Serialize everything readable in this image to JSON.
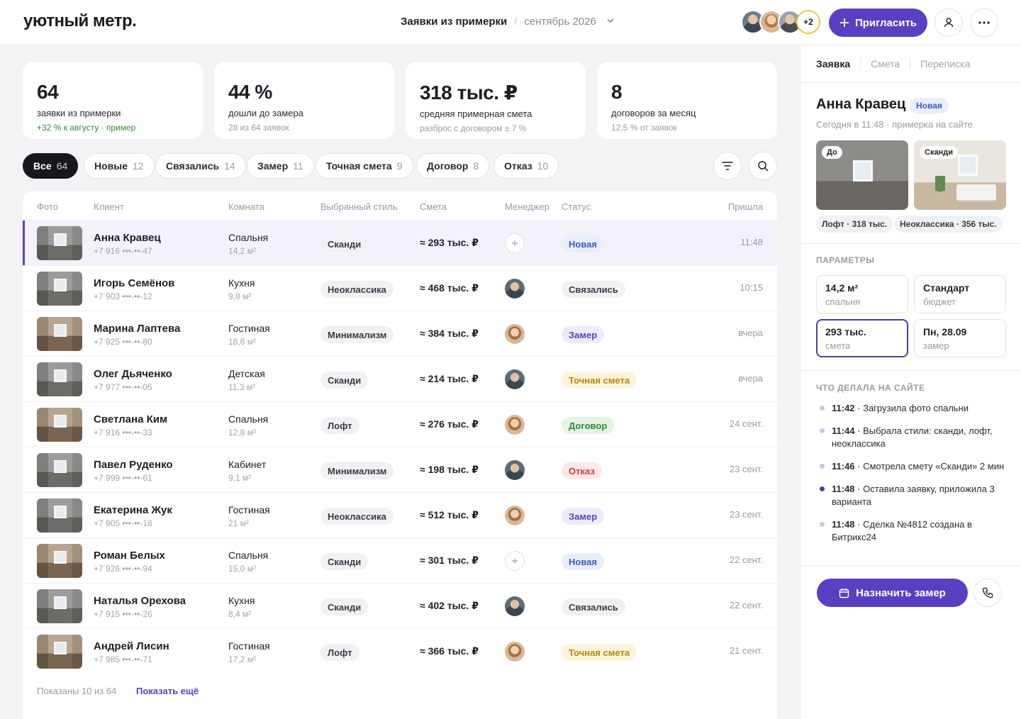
{
  "header": {
    "logo": "уютный метр.",
    "breadcrumb_current": "Заявки из примерки",
    "breadcrumb_sep": "/",
    "period": "сентябрь 2026",
    "avatars_more": "+2",
    "invite_label": "Пригласить"
  },
  "kpis": [
    {
      "value": "64",
      "label": "заявки из примерки",
      "sub": "+32 % к августу · пример"
    },
    {
      "value": "44 %",
      "label": "дошли до замера",
      "sub": "28 из 64 заявок"
    },
    {
      "value": "318 тыс. ₽",
      "label": "средняя примерная смета",
      "sub": "разброс с договором ± 7 %"
    },
    {
      "value": "8",
      "label": "договоров за месяц",
      "sub": "12,5 % от заявок"
    }
  ],
  "filters": [
    {
      "label": "Все",
      "count": "64"
    },
    {
      "label": "Новые",
      "count": "12"
    },
    {
      "label": "Связались",
      "count": "14"
    },
    {
      "label": "Замер",
      "count": "11"
    },
    {
      "label": "Точная смета",
      "count": "9"
    },
    {
      "label": "Договор",
      "count": "8"
    },
    {
      "label": "Отказ",
      "count": "10"
    }
  ],
  "table": {
    "columns": [
      "Фото",
      "Клиент",
      "Комната",
      "Выбранный стиль",
      "Смета",
      "Менеджер",
      "Статус",
      "Пришла"
    ],
    "rows": [
      {
        "name": "Анна Кравец",
        "phone": "+7 916 •••-••-47",
        "room": "Спальня",
        "area": "14,2 м²",
        "style": "Сканди",
        "estimate": "≈ 293 тыс. ₽",
        "status": "Новая",
        "came": "11:48"
      },
      {
        "name": "Игорь Семёнов",
        "phone": "+7 903 •••-••-12",
        "room": "Кухня",
        "area": "9,8 м²",
        "style": "Неоклассика",
        "estimate": "≈ 468 тыс. ₽",
        "status": "Связались",
        "came": "10:15"
      },
      {
        "name": "Марина Лаптева",
        "phone": "+7 925 •••-••-80",
        "room": "Гостиная",
        "area": "18,6 м²",
        "style": "Минимализм",
        "estimate": "≈ 384 тыс. ₽",
        "status": "Замер",
        "came": "вчера"
      },
      {
        "name": "Олег Дьяченко",
        "phone": "+7 977 •••-••-05",
        "room": "Детская",
        "area": "11,3 м²",
        "style": "Сканди",
        "estimate": "≈ 214 тыс. ₽",
        "status": "Точная смета",
        "came": "вчера"
      },
      {
        "name": "Светлана Ким",
        "phone": "+7 916 •••-••-33",
        "room": "Спальня",
        "area": "12,8 м²",
        "style": "Лофт",
        "estimate": "≈ 276 тыс. ₽",
        "status": "Договор",
        "came": "24 сент."
      },
      {
        "name": "Павел Руденко",
        "phone": "+7 999 •••-••-61",
        "room": "Кабинет",
        "area": "9,1 м²",
        "style": "Минимализм",
        "estimate": "≈ 198 тыс. ₽",
        "status": "Отказ",
        "came": "23 сент."
      },
      {
        "name": "Екатерина Жук",
        "phone": "+7 905 •••-••-18",
        "room": "Гостиная",
        "area": "21 м²",
        "style": "Неоклассика",
        "estimate": "≈ 512 тыс. ₽",
        "status": "Замер",
        "came": "23 сент."
      },
      {
        "name": "Роман Белых",
        "phone": "+7 926 •••-••-94",
        "room": "Спальня",
        "area": "15,0 м²",
        "style": "Сканди",
        "estimate": "≈ 301 тыс. ₽",
        "status": "Новая",
        "came": "22 сент."
      },
      {
        "name": "Наталья Орехова",
        "phone": "+7 915 •••-••-26",
        "room": "Кухня",
        "area": "8,4 м²",
        "style": "Сканди",
        "estimate": "≈ 402 тыс. ₽",
        "status": "Связались",
        "came": "22 сент."
      },
      {
        "name": "Андрей Лисин",
        "phone": "+7 985 •••-••-71",
        "room": "Гостиная",
        "area": "17,2 м²",
        "style": "Лофт",
        "estimate": "≈ 366 тыс. ₽",
        "status": "Точная смета",
        "came": "21 сент."
      }
    ],
    "footer_text": "Показаны 10 из 64",
    "show_more": "Показать ещё"
  },
  "status_colors": {
    "Новая": {
      "bg": "#e8eefc",
      "fg": "#3b5bc9"
    },
    "Связались": {
      "bg": "#f1f1f4",
      "fg": "#3a3a42"
    },
    "Замер": {
      "bg": "#ecebfb",
      "fg": "#5a3fc2"
    },
    "Точная смета": {
      "bg": "#fdf3dc",
      "fg": "#b8860b"
    },
    "Договор": {
      "bg": "#e4f4e4",
      "fg": "#2f8a3a"
    },
    "Отказ": {
      "bg": "#fde8e8",
      "fg": "#c9403a"
    }
  },
  "panel": {
    "tabs": [
      "Заявка",
      "Смета",
      "Переписка"
    ],
    "name": "Анна Кравец",
    "badge": "Новая",
    "meta": "Сегодня в 11:48 · примерка на сайте",
    "photo_before_tag": "До",
    "photo_after_tag": "Сканди",
    "caption_before": "Лофт · 318 тыс.",
    "caption_after": "Неоклассика · 356 тыс.",
    "params_title": "ПАРАМЕТРЫ",
    "params": [
      {
        "value": "14,2 м²",
        "label": "спальня"
      },
      {
        "value": "Стандарт",
        "label": "бюджет"
      },
      {
        "value": "293 тыс.",
        "label": "смета"
      },
      {
        "value": "Пн, 28.09",
        "label": "замер"
      }
    ],
    "timeline_title": "ЧТО ДЕЛАЛА НА САЙТЕ",
    "timeline": [
      {
        "time": "11:42",
        "text": " · Загрузила фото спальни"
      },
      {
        "time": "11:44",
        "text": " · Выбрала стили: сканди, лофт, неоклассика"
      },
      {
        "time": "11:46",
        "text": " · Смотрела смету «Сканди» 2 мин"
      },
      {
        "time": "11:48",
        "text": " · Оставила заявку, приложила 3 варианта"
      },
      {
        "time": "11:48",
        "text": " · Сделка №4812 создана в Битрикс24"
      }
    ],
    "book_label": "Назначить замер"
  }
}
